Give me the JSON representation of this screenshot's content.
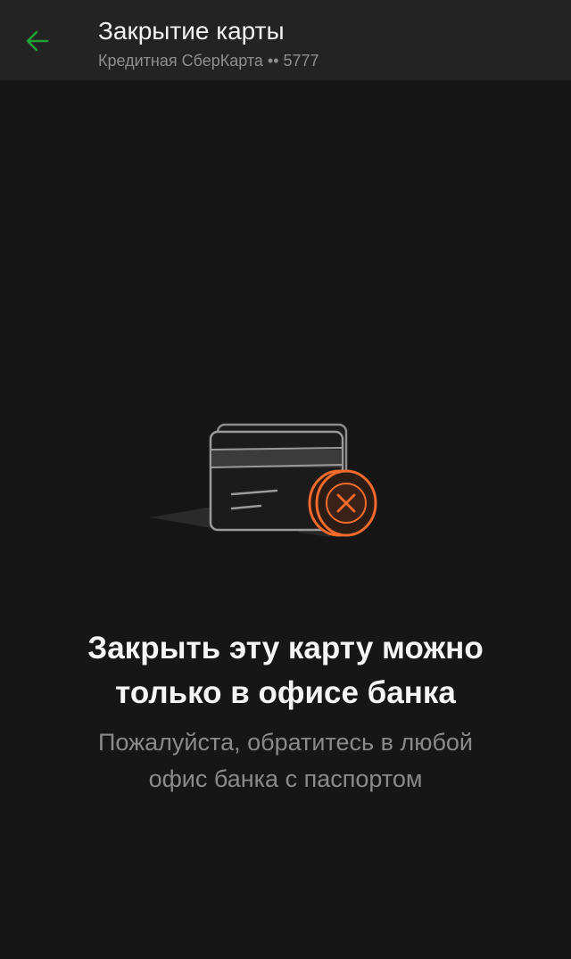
{
  "app_bar": {
    "back_icon": "arrow-left-icon",
    "title": "Закрытие карты",
    "subtitle": "Кредитная СберКарта •• 5777"
  },
  "illustration": {
    "card_icon": "credit-card-icon",
    "badge_icon": "close-icon"
  },
  "message": {
    "heading_line1": "Закрыть эту карту можно",
    "heading_line2": "только в офисе банка",
    "description_line1": "Пожалуйста, обратитесь в любой",
    "description_line2": "офис банка с паспортом"
  },
  "colors": {
    "background": "#161616",
    "app_bar": "#232323",
    "accent_green": "#21a038",
    "accent_orange": "#f26b2c"
  }
}
